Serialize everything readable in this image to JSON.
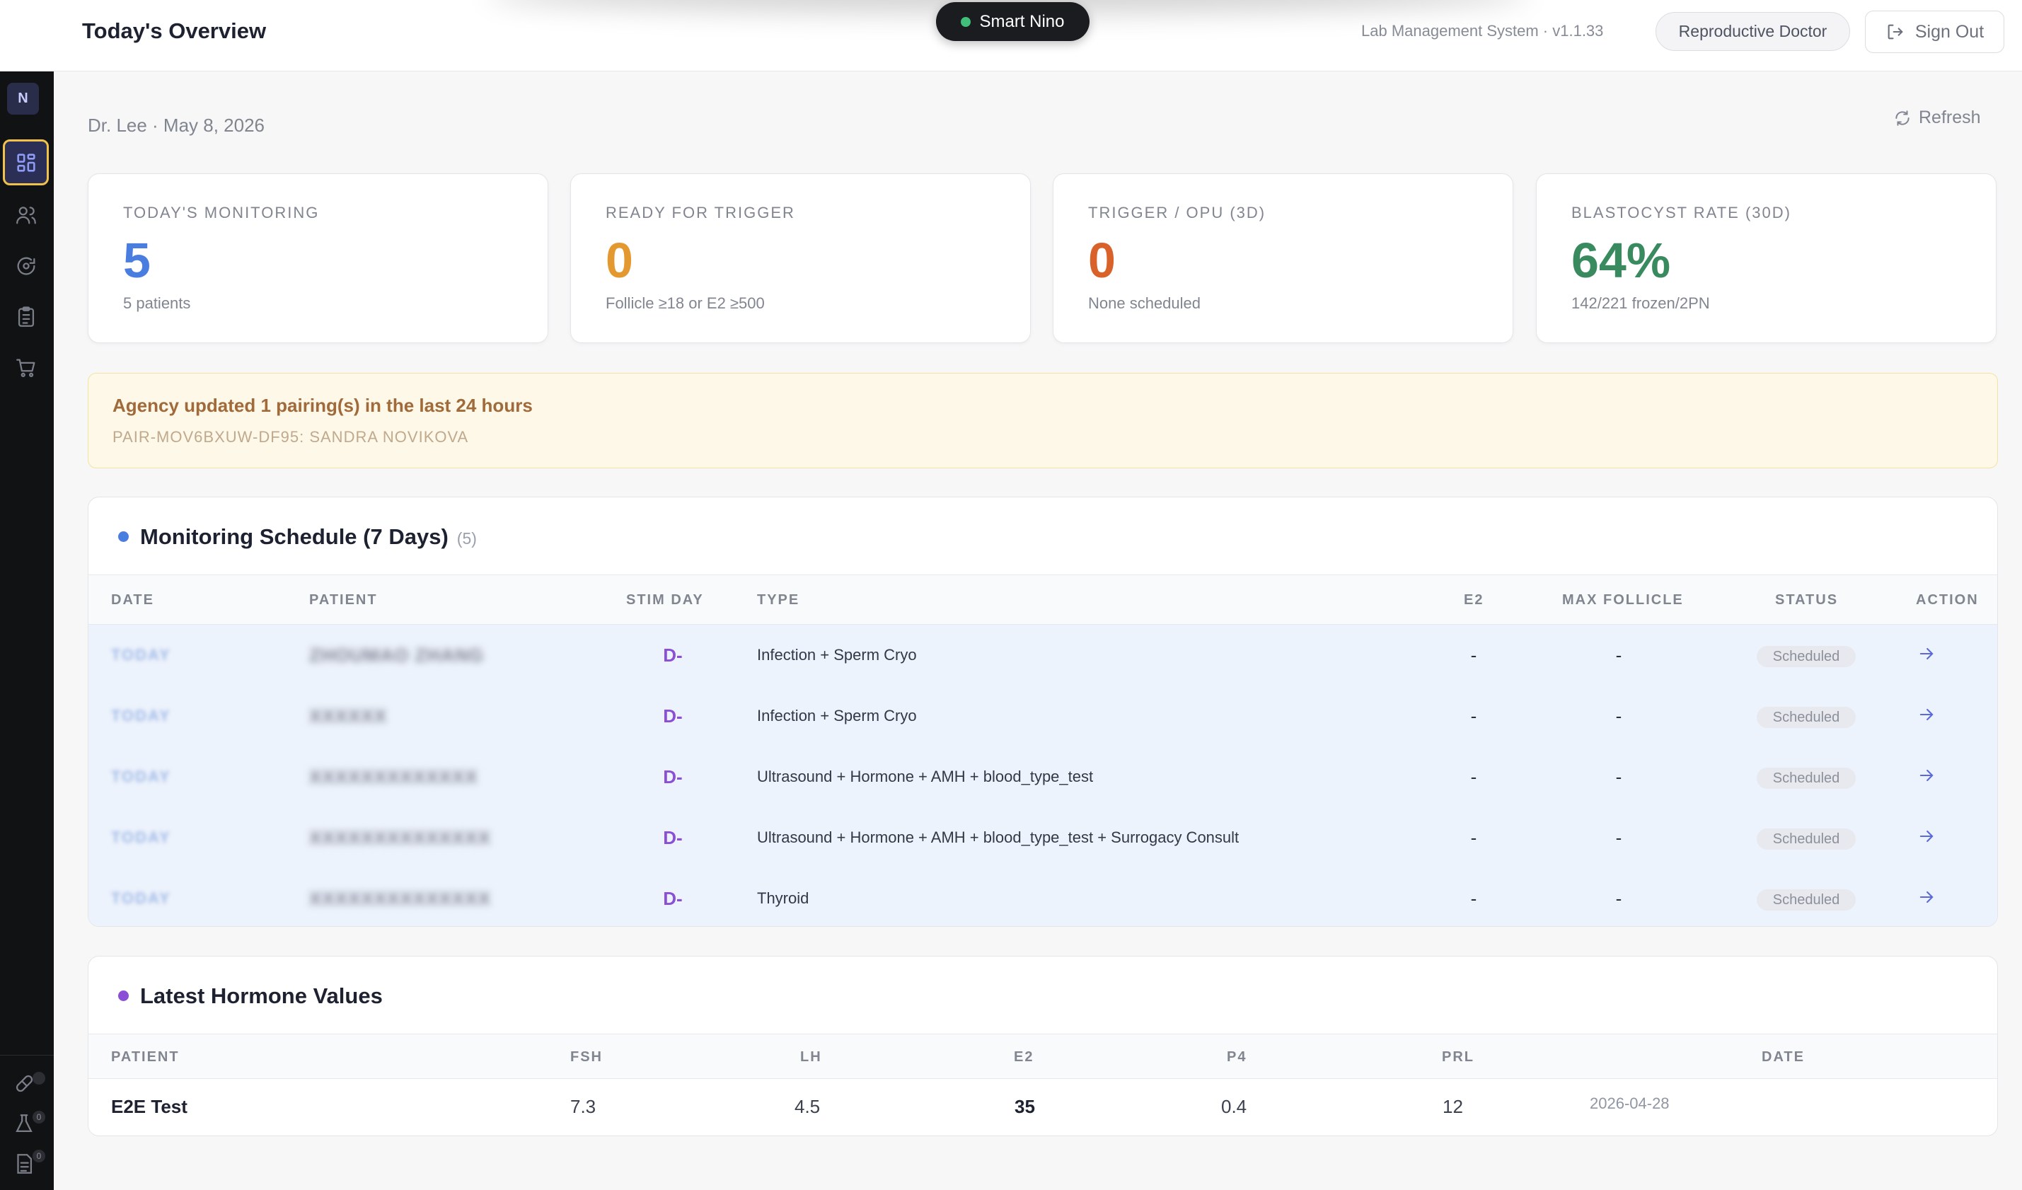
{
  "header": {
    "title": "Today's Overview",
    "assistant": "Smart Nino",
    "system_version": "Lab Management System · v1.1.33",
    "role": "Reproductive Doctor",
    "sign_out": "Sign Out"
  },
  "sidebar": {
    "avatar_initial": "N",
    "items": [
      {
        "icon": "dashboard-icon",
        "active": true
      },
      {
        "icon": "users-icon",
        "active": false
      },
      {
        "icon": "cycle-icon",
        "active": false
      },
      {
        "icon": "clipboard-icon",
        "active": false
      },
      {
        "icon": "cart-icon",
        "active": false
      }
    ],
    "bottom": [
      {
        "icon": "pill-icon",
        "badge": ""
      },
      {
        "icon": "flask-icon",
        "badge": "0"
      },
      {
        "icon": "document-icon",
        "badge": "0"
      }
    ]
  },
  "subheader": {
    "context": "Dr. Lee · May 8, 2026",
    "refresh": "Refresh"
  },
  "stats": [
    {
      "label": "TODAY'S MONITORING",
      "value": "5",
      "caption": "5 patients",
      "color": "#4a7de0"
    },
    {
      "label": "READY FOR TRIGGER",
      "value": "0",
      "caption": "Follicle ≥18 or E2 ≥500",
      "color": "#e3992f"
    },
    {
      "label": "TRIGGER / OPU (3D)",
      "value": "0",
      "caption": "None scheduled",
      "color": "#d9622b"
    },
    {
      "label": "BLASTOCYST RATE (30D)",
      "value": "64%",
      "caption": "142/221 frozen/2PN",
      "color": "#3a8a5f"
    }
  ],
  "notice": {
    "title": "Agency updated 1 pairing(s) in the last 24 hours",
    "detail": "PAIR-MOV6BXUW-DF95: SANDRA NOVIKOVA"
  },
  "monitoring": {
    "title": "Monitoring Schedule (7 Days)",
    "count": "(5)",
    "dot_color": "#4a7de0",
    "columns": [
      "DATE",
      "PATIENT",
      "STIM DAY",
      "TYPE",
      "E2",
      "MAX FOLLICLE",
      "STATUS",
      "ACTION"
    ],
    "rows": [
      {
        "date": "TODAY",
        "patient": "ZHOUMAO ZHANG",
        "stim": "D-",
        "type": "Infection + Sperm Cryo",
        "e2": "-",
        "follicle": "-",
        "status": "Scheduled"
      },
      {
        "date": "TODAY",
        "patient": "XXXXXX",
        "stim": "D-",
        "type": "Infection + Sperm Cryo",
        "e2": "-",
        "follicle": "-",
        "status": "Scheduled"
      },
      {
        "date": "TODAY",
        "patient": "XXXXXXXXXXXXX",
        "stim": "D-",
        "type": "Ultrasound + Hormone + AMH + blood_type_test",
        "e2": "-",
        "follicle": "-",
        "status": "Scheduled"
      },
      {
        "date": "TODAY",
        "patient": "XXXXXXXXXXXXXX",
        "stim": "D-",
        "type": "Ultrasound + Hormone + AMH + blood_type_test + Surrogacy Consult",
        "e2": "-",
        "follicle": "-",
        "status": "Scheduled"
      },
      {
        "date": "TODAY",
        "patient": "XXXXXXXXXXXXXX",
        "stim": "D-",
        "type": "Thyroid",
        "e2": "-",
        "follicle": "-",
        "status": "Scheduled"
      }
    ]
  },
  "hormones": {
    "title": "Latest Hormone Values",
    "dot_color": "#8a4fd6",
    "columns": [
      "PATIENT",
      "FSH",
      "LH",
      "E2",
      "P4",
      "PRL",
      "DATE"
    ],
    "rows": [
      {
        "patient": "E2E Test",
        "fsh": "7.3",
        "lh": "4.5",
        "e2": "35",
        "p4": "0.4",
        "prl": "12",
        "date": "2026-04-28"
      }
    ]
  }
}
